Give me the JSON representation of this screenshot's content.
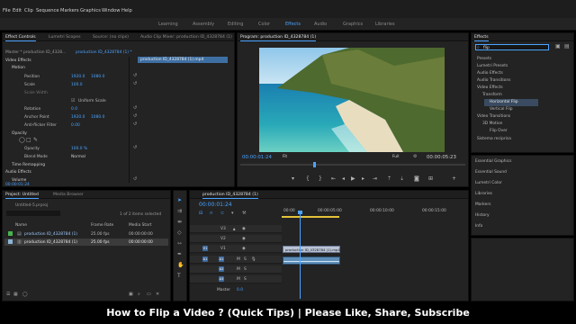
{
  "menu": [
    "File",
    "Edit",
    "Clip",
    "Sequence",
    "Markers",
    "Graphics",
    "Window",
    "Help"
  ],
  "workspaces": [
    "Learning",
    "Assembly",
    "Editing",
    "Color",
    "Effects",
    "Audio",
    "Graphics",
    "Libraries"
  ],
  "active_workspace": "Effects",
  "effect_controls": {
    "tabs": [
      "Effect Controls",
      "Lumetri Scopes",
      "Source: (no clips)",
      "Audio Clip Mixer: production ID_4328784 (1)"
    ],
    "clip_path": "Master * production ID_4328...",
    "clip_seq": "production ID_4328784 (1) *",
    "clip_bar": "production ID_4328784 (1).mp4",
    "video_effects": "Video Effects",
    "motion": "Motion",
    "position": "Position",
    "position_x": "1920.0",
    "position_y": "1080.0",
    "scale": "Scale",
    "scale_val": "100.0",
    "scale_width": "Scale Width",
    "uniform_scale": "Uniform Scale",
    "rotation": "Rotation",
    "rotation_val": "0.0",
    "anchor": "Anchor Point",
    "anchor_x": "1920.0",
    "anchor_y": "1080.0",
    "antiflicker": "Anti-flicker Filter",
    "antiflicker_val": "0.00",
    "opacity_group": "Opacity",
    "opacity": "Opacity",
    "opacity_val": "100.0 %",
    "blend": "Blend Mode",
    "blend_val": "Normal",
    "time_remap": "Time Remapping",
    "audio_effects": "Audio Effects",
    "volume": "Volume",
    "timecode": "00:00:01:24"
  },
  "program": {
    "title": "Program: production ID_4328784 (1)",
    "timecode": "00:00:01:24",
    "fit": "Fit",
    "quality": "Full",
    "duration": "00:00:05:23"
  },
  "effects": {
    "title": "Effects",
    "search": "flip",
    "tree": [
      "Presets",
      "Lumetri Presets",
      "Audio Effects",
      "Audio Transitions",
      "Video Effects",
      "Transform",
      "Horizontal Flip",
      "Vertical Flip",
      "Video Transitions",
      "3D Motion",
      "Flip Over",
      "Sistema reciprisa"
    ],
    "side_panels": [
      "Essential Graphics",
      "Essential Sound",
      "Lumetri Color",
      "Libraries",
      "Markers",
      "History",
      "Info"
    ]
  },
  "project": {
    "tabs": [
      "Project: Untitled",
      "Media Browser"
    ],
    "file": "Untitled-5.prproj",
    "count": "1 of 2 items selected",
    "cols": [
      "Name",
      "Frame Rate",
      "Media Start"
    ],
    "items": [
      {
        "name": "production ID_4328784 (1)",
        "rate": "25.00 fps",
        "start": "00:00:00:00"
      },
      {
        "name": "production ID_4328784 (1)",
        "rate": "25.00 fps",
        "start": "00:00:00:00"
      }
    ]
  },
  "timeline": {
    "title": "production ID_4328784 (1)",
    "timecode": "00:00:01:24",
    "ruler": [
      "00:00",
      "00:00:05:00",
      "00:00:10:00",
      "00:00:15:00"
    ],
    "tracks_v": [
      "V3",
      "V2",
      "V1"
    ],
    "tracks_a": [
      "A1",
      "A2",
      "A3"
    ],
    "master": "Master",
    "master_val": "0.0",
    "video_clip": "production ID_4328784 (1).mp4"
  },
  "caption": "How to Flip a Video ? (Quick Tips) | Please Like, Share, Subscribe",
  "colors": {
    "accent": "#4aa3ff",
    "panel": "#232323",
    "dark": "#1d1d1d",
    "clip_video": "#b9c3d6",
    "clip_audio": "#5f8fb8"
  }
}
